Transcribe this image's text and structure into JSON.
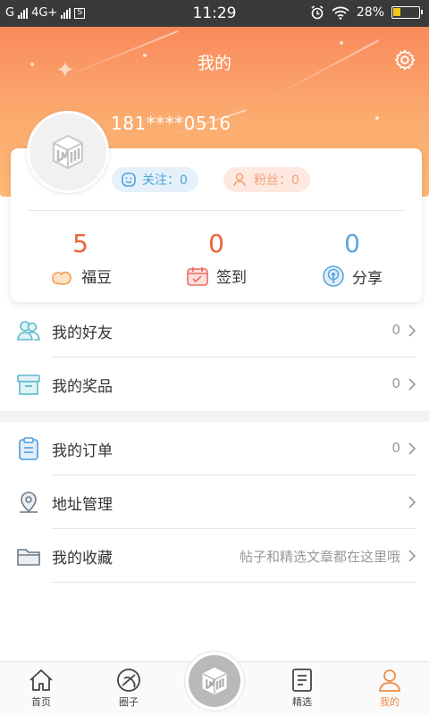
{
  "status_bar": {
    "carrier": "G",
    "network": "4G+",
    "sim_icon": "S",
    "time": "11:29",
    "battery": "28%"
  },
  "header": {
    "title": "我的",
    "settings_icon": "gear-icon"
  },
  "profile": {
    "phone": "181****0516",
    "follow_label": "关注：0",
    "fans_label": "粉丝：0"
  },
  "stats": [
    {
      "value": "5",
      "label": "福豆",
      "icon": "bean-icon"
    },
    {
      "value": "0",
      "label": "签到",
      "icon": "calendar-icon"
    },
    {
      "value": "0",
      "label": "分享",
      "icon": "share-icon"
    }
  ],
  "menu": [
    {
      "label": "我的好友",
      "value": "0",
      "icon": "friends-icon"
    },
    {
      "label": "我的奖品",
      "value": "0",
      "icon": "prize-box-icon"
    },
    {
      "label": "我的订单",
      "value": "0",
      "icon": "clipboard-icon"
    },
    {
      "label": "地址管理",
      "value": "",
      "icon": "location-icon"
    },
    {
      "label": "我的收藏",
      "value": "帖子和精选文章都在这里哦",
      "icon": "folder-icon"
    }
  ],
  "bottom_nav": {
    "home": "首页",
    "circle": "圈子",
    "select": "精选",
    "mine": "我的"
  },
  "colors": {
    "accent": "#f08a43",
    "header_top": "#f98a5c",
    "header_bottom": "#fdb774",
    "blue": "#5aa8e0"
  }
}
